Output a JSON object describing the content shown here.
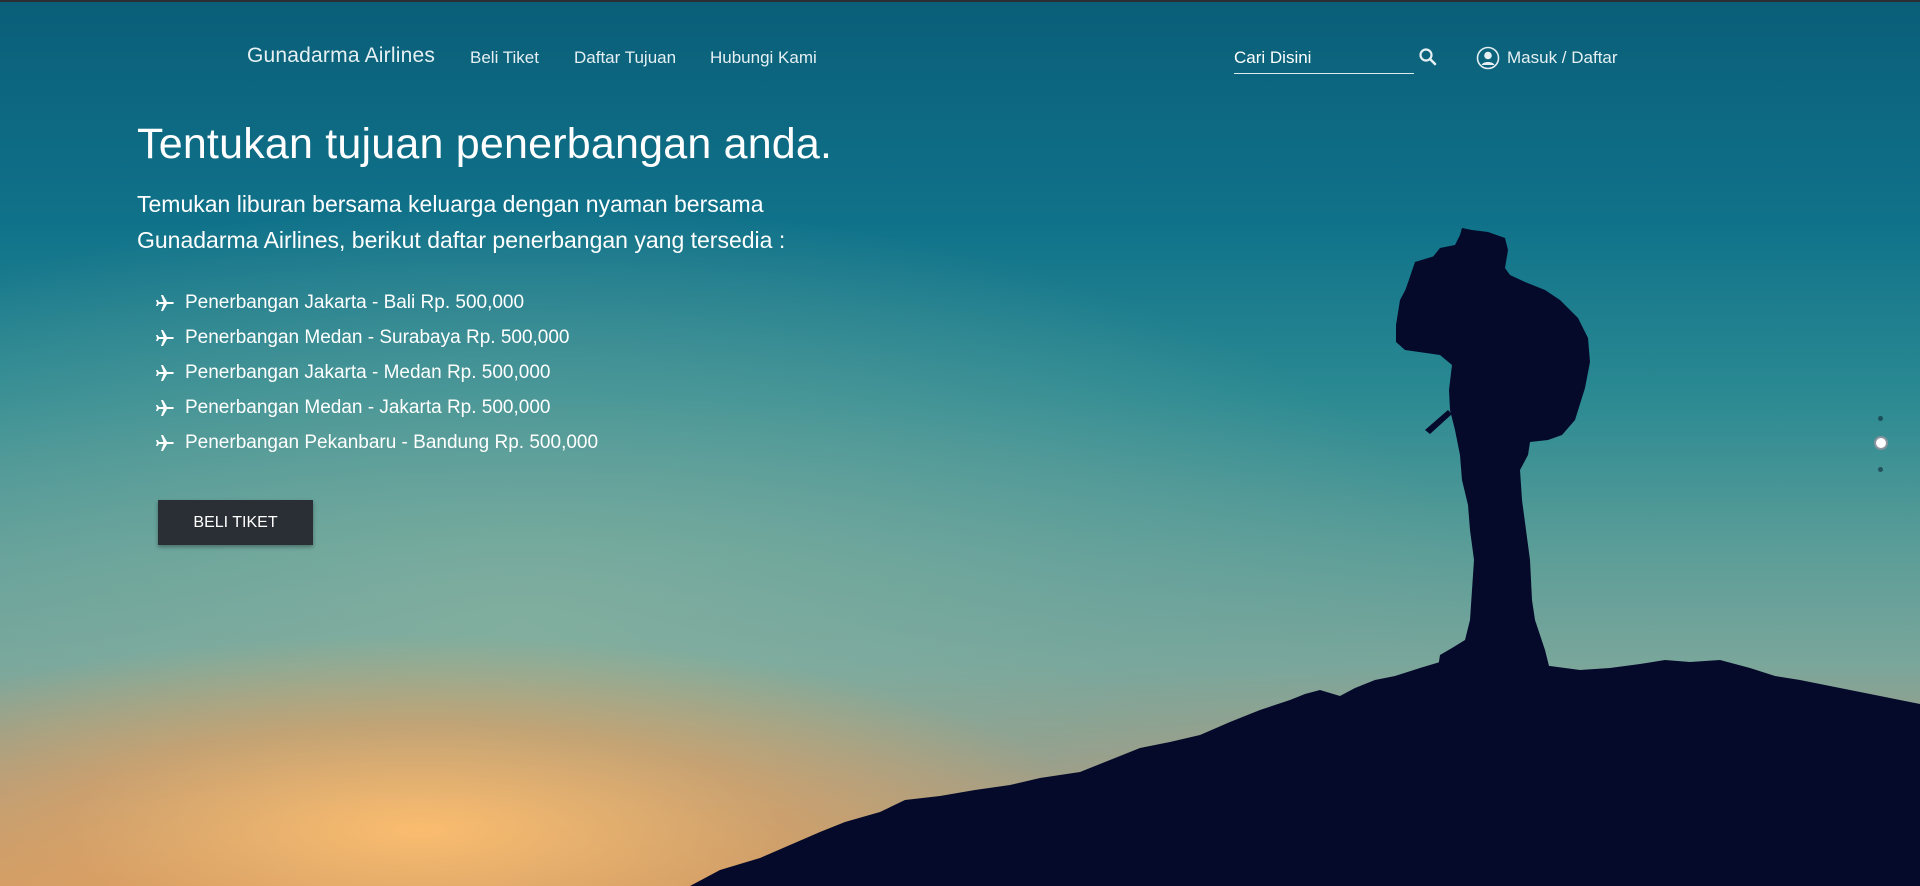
{
  "nav": {
    "brand": "Gunadarma Airlines",
    "links": [
      "Beli Tiket",
      "Daftar Tujuan",
      "Hubungi Kami"
    ],
    "search_placeholder": "Cari Disini",
    "login": "Masuk / Daftar"
  },
  "hero": {
    "title": "Tentukan tujuan penerbangan anda.",
    "subtitle_line1": "Temukan liburan bersama keluarga dengan nyaman bersama",
    "subtitle_line2": "Gunadarma Airlines, berikut daftar penerbangan yang tersedia :",
    "flights": [
      "Penerbangan Jakarta - Bali Rp. 500,000",
      "Penerbangan Medan - Surabaya Rp. 500,000",
      "Penerbangan Jakarta - Medan Rp. 500,000",
      "Penerbangan Medan - Jakarta Rp. 500,000",
      "Penerbangan Pekanbaru - Bandung Rp. 500,000"
    ],
    "button": "BELI TIKET"
  },
  "slider": {
    "active_index": 1,
    "count": 3
  },
  "icons": {
    "search": "search-icon",
    "user": "user-circle-icon",
    "list_item": "plane-icon"
  },
  "colors": {
    "button_bg": "#2a2f35",
    "text": "#ffffff",
    "silhouette": "#050a2a"
  }
}
